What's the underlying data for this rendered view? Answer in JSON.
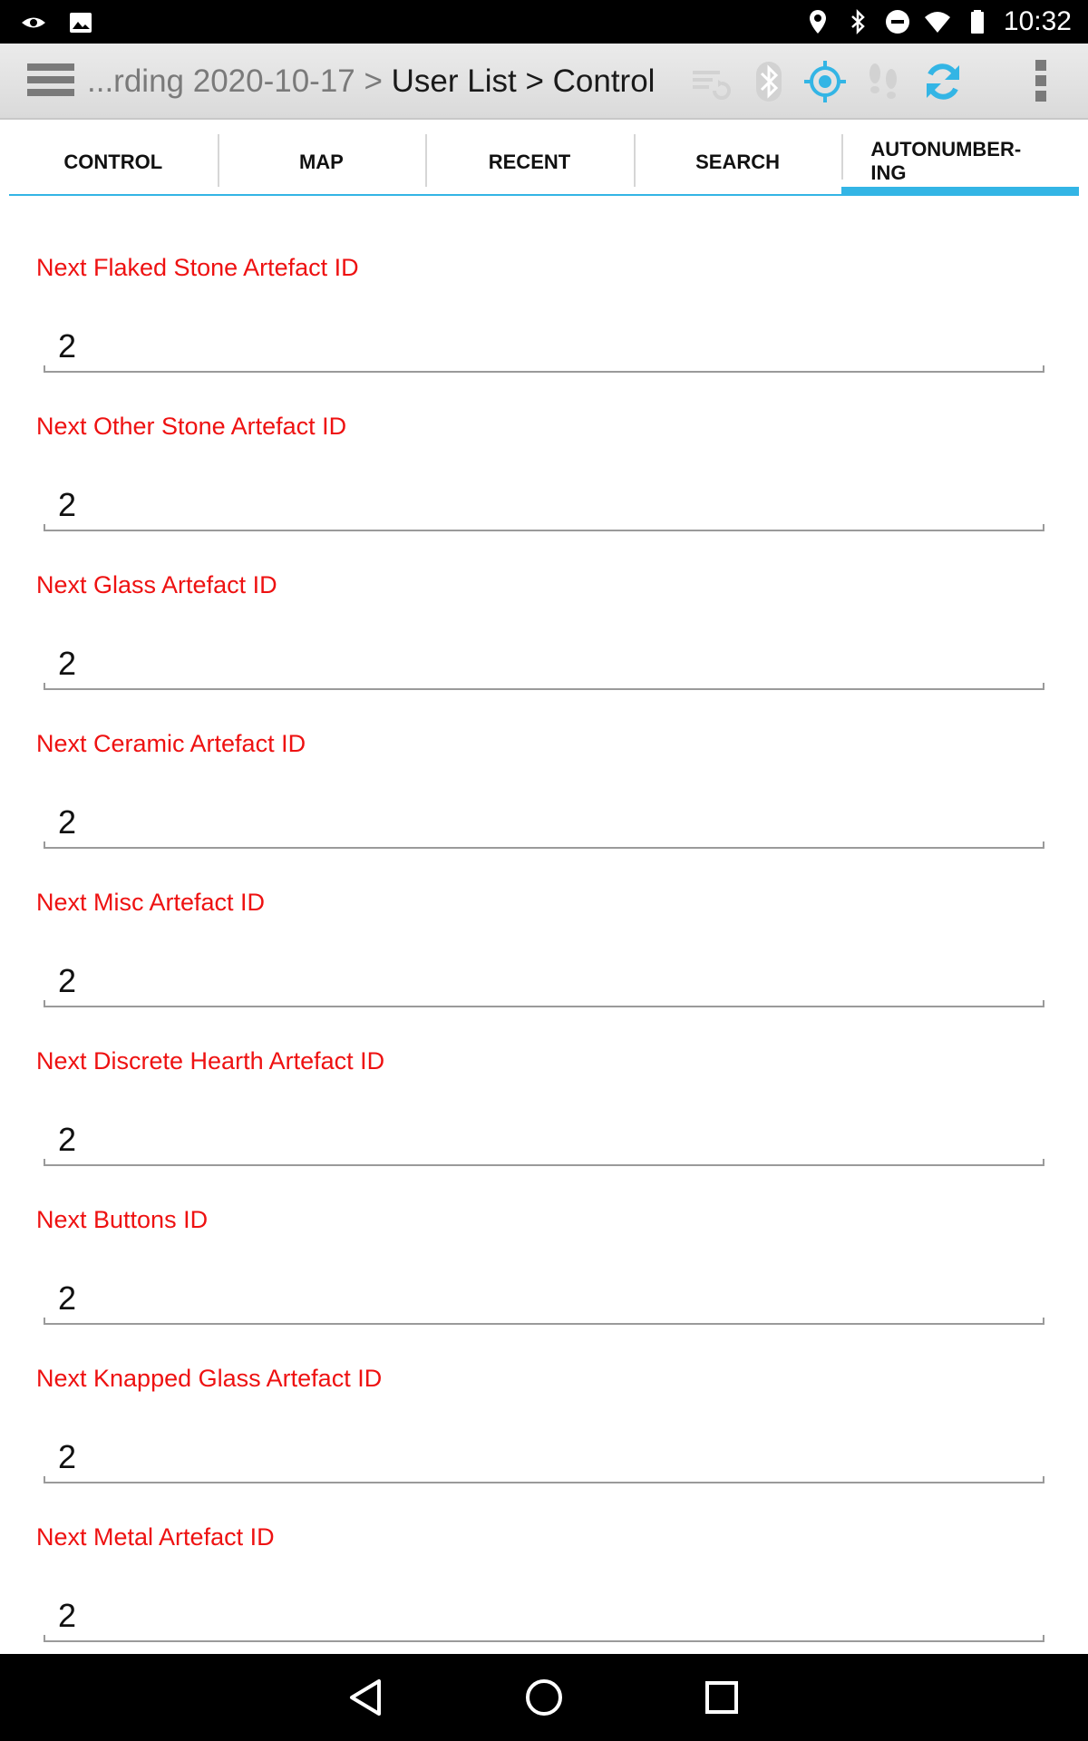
{
  "status_bar": {
    "time": "10:32",
    "icons": [
      "eye-icon",
      "image-icon",
      "location-pin-icon",
      "bluetooth-icon",
      "do-not-disturb-icon",
      "wifi-icon",
      "battery-icon"
    ]
  },
  "action_bar": {
    "breadcrumb_prefix": "...rding 2020-10-17 > ",
    "breadcrumb_current": "User List > Control",
    "icons": [
      "sync-status-icon",
      "bluetooth-icon",
      "gps-icon",
      "footsteps-icon",
      "refresh-icon",
      "overflow-menu-icon"
    ],
    "colors": {
      "accent": "#33b5e5",
      "inactive": "#d2d2d2"
    }
  },
  "tabs": [
    {
      "label": "CONTROL",
      "active": false
    },
    {
      "label": "MAP",
      "active": false
    },
    {
      "label": "RECENT",
      "active": false
    },
    {
      "label": "SEARCH",
      "active": false
    },
    {
      "label": "AUTONUMBER-\nING",
      "active": true
    }
  ],
  "fields": [
    {
      "label": "Next Flaked Stone Artefact ID",
      "value": "2"
    },
    {
      "label": "Next Other Stone Artefact ID",
      "value": "2"
    },
    {
      "label": "Next Glass Artefact ID",
      "value": "2"
    },
    {
      "label": "Next Ceramic Artefact ID",
      "value": "2"
    },
    {
      "label": "Next Misc Artefact ID",
      "value": "2"
    },
    {
      "label": "Next Discrete Hearth Artefact ID",
      "value": "2"
    },
    {
      "label": "Next Buttons ID",
      "value": "2"
    },
    {
      "label": "Next Knapped Glass Artefact ID",
      "value": "2"
    },
    {
      "label": "Next Metal Artefact ID",
      "value": "2"
    }
  ],
  "nav_bar": {
    "buttons": [
      "back-icon",
      "home-icon",
      "recents-icon"
    ]
  },
  "colors": {
    "label_red": "#ee1111",
    "tab_accent": "#33b5e5"
  }
}
